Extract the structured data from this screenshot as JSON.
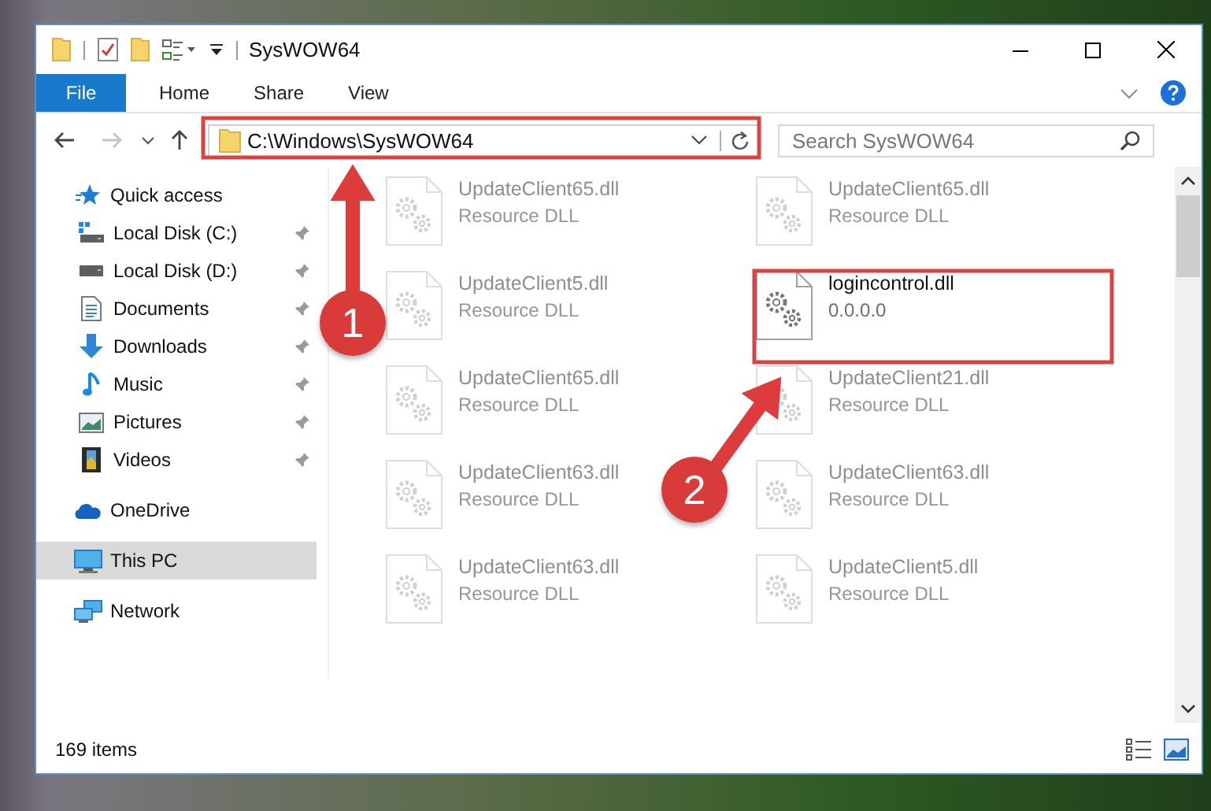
{
  "window": {
    "title": "SysWOW64"
  },
  "ribbon": {
    "tabs": [
      {
        "label": "File",
        "kind": "file"
      },
      {
        "label": "Home",
        "kind": "tab"
      },
      {
        "label": "Share",
        "kind": "tab"
      },
      {
        "label": "View",
        "kind": "tab"
      }
    ]
  },
  "address_bar": {
    "path": "C:\\Windows\\SysWOW64"
  },
  "search": {
    "placeholder": "Search SysWOW64"
  },
  "sidebar": {
    "items": [
      {
        "label": "Quick access",
        "kind": "star",
        "selected": false,
        "children": [
          {
            "label": "Local Disk (C:)",
            "kind": "system-drive",
            "pinned": true,
            "selected": false
          },
          {
            "label": "Local Disk (D:)",
            "kind": "drive",
            "pinned": true,
            "selected": false
          },
          {
            "label": "Documents",
            "kind": "documents",
            "pinned": true,
            "selected": false
          },
          {
            "label": "Downloads",
            "kind": "downloads",
            "pinned": true,
            "selected": false
          },
          {
            "label": "Music",
            "kind": "music",
            "pinned": true,
            "selected": false
          },
          {
            "label": "Pictures",
            "kind": "pictures",
            "pinned": true,
            "selected": false
          },
          {
            "label": "Videos",
            "kind": "videos",
            "pinned": true,
            "selected": false
          }
        ]
      },
      {
        "label": "OneDrive",
        "kind": "cloud",
        "selected": false
      },
      {
        "label": "This PC",
        "kind": "pc",
        "selected": true
      },
      {
        "label": "Network",
        "kind": "network",
        "selected": false
      }
    ]
  },
  "files": [
    {
      "name": "UpdateClient65.dll",
      "type": "Resource DLL",
      "dimmed": true
    },
    {
      "name": "UpdateClient65.dll",
      "type": "Resource DLL",
      "dimmed": true
    },
    {
      "name": "UpdateClient5.dll",
      "type": "Resource DLL",
      "dimmed": true
    },
    {
      "name": "logincontrol.dll",
      "type": "0.0.0.0",
      "dimmed": false
    },
    {
      "name": "UpdateClient65.dll",
      "type": "Resource DLL",
      "dimmed": true
    },
    {
      "name": "UpdateClient21.dll",
      "type": "Resource DLL",
      "dimmed": true
    },
    {
      "name": "UpdateClient63.dll",
      "type": "Resource DLL",
      "dimmed": true
    },
    {
      "name": "UpdateClient63.dll",
      "type": "Resource DLL",
      "dimmed": true
    },
    {
      "name": "UpdateClient63.dll",
      "type": "Resource DLL",
      "dimmed": true
    },
    {
      "name": "UpdateClient5.dll",
      "type": "Resource DLL",
      "dimmed": true
    }
  ],
  "status_bar": {
    "item_count": "169 items"
  },
  "annotations": [
    {
      "number": "1"
    },
    {
      "number": "2"
    }
  ]
}
